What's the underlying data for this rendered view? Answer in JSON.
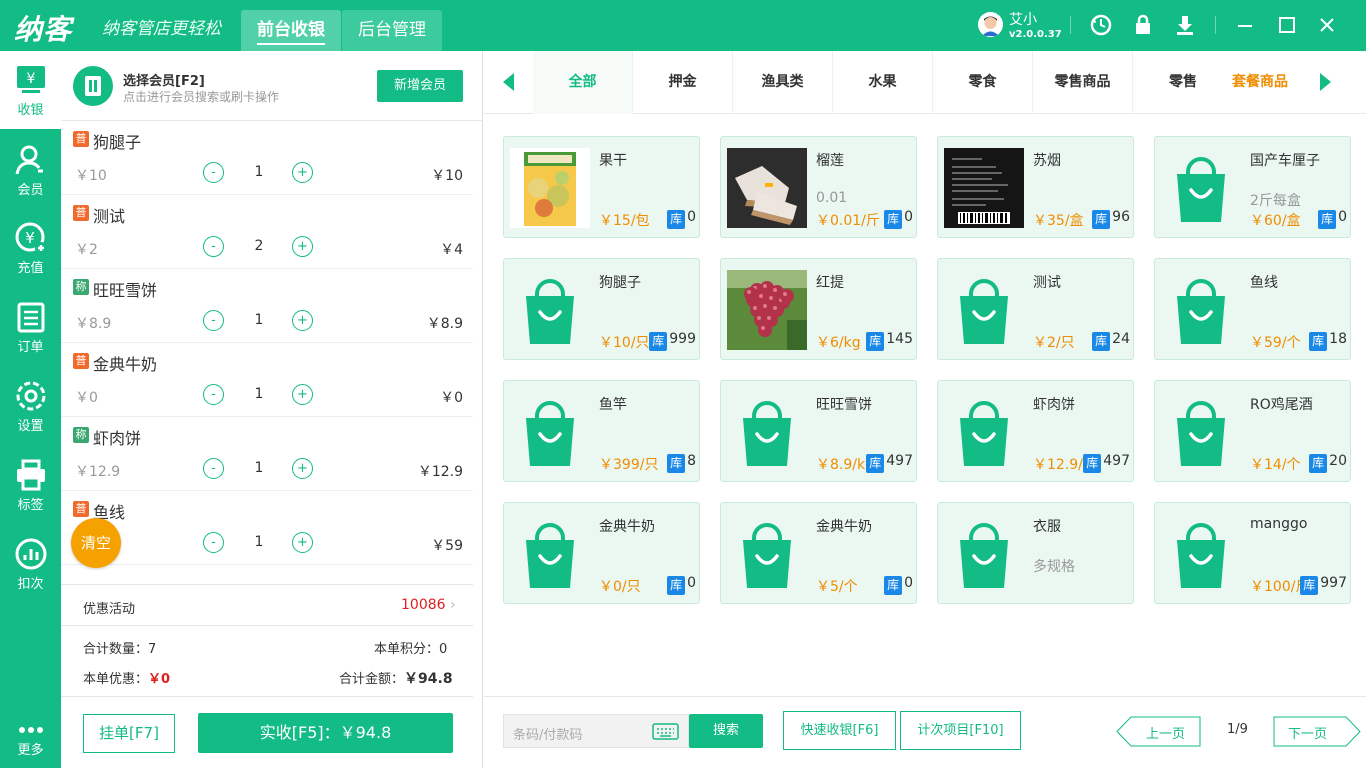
{
  "app": {
    "logo": "纳客",
    "slogan": "纳客管店更轻松",
    "nav_tabs": [
      {
        "label": "前台收银"
      },
      {
        "label": "后台管理"
      }
    ],
    "user": {
      "name": "艾小",
      "version": "v2.0.0.37"
    },
    "accent_color": "#13bb85"
  },
  "sidebar": {
    "items": [
      {
        "label": "收银",
        "icon": "cashier-icon"
      },
      {
        "label": "会员",
        "icon": "member-icon"
      },
      {
        "label": "充值",
        "icon": "recharge-icon"
      },
      {
        "label": "订单",
        "icon": "order-icon"
      },
      {
        "label": "设置",
        "icon": "settings-icon"
      },
      {
        "label": "标签",
        "icon": "printer-icon"
      },
      {
        "label": "扣次",
        "icon": "deduct-icon"
      },
      {
        "label": "更多",
        "icon": "more-icon"
      }
    ]
  },
  "member": {
    "title": "选择会员[F2]",
    "subtitle": "点击进行会员搜索或刷卡操作",
    "add_button": "新增会员"
  },
  "cart": {
    "items": [
      {
        "tag": "普",
        "name": "狗腿子",
        "price": "￥10",
        "qty": "1",
        "total": "￥10"
      },
      {
        "tag": "普",
        "name": "测试",
        "price": "￥2",
        "qty": "2",
        "total": "￥4"
      },
      {
        "tag": "称",
        "name": "旺旺雪饼",
        "price": "￥8.9",
        "qty": "1",
        "total": "￥8.9"
      },
      {
        "tag": "普",
        "name": "金典牛奶",
        "price": "￥0",
        "qty": "1",
        "total": "￥0"
      },
      {
        "tag": "称",
        "name": "虾肉饼",
        "price": "￥12.9",
        "qty": "1",
        "total": "￥12.9"
      },
      {
        "tag": "普",
        "name": "鱼线",
        "price": "",
        "qty": "1",
        "total": "￥59"
      }
    ],
    "minus": "-",
    "plus": "+",
    "clear_button": "清空"
  },
  "summary": {
    "promo_label": "优惠活动",
    "promo_value": "10086",
    "total_qty_label": "合计数量：",
    "total_qty": "7",
    "points_label": "本单积分：",
    "points": "0",
    "discount_label": "本单优惠：",
    "discount": "￥0",
    "amount_label": "合计金额：",
    "amount": "￥94.8",
    "hold_button": "挂单[F7]",
    "pay_button": "实收[F5]：￥94.8"
  },
  "categories": [
    "全部",
    "押金",
    "渔具类",
    "水果",
    "零食",
    "零售商品",
    "零售",
    "套餐商品"
  ],
  "active_category": "全部",
  "products": [
    {
      "name": "果干",
      "spec": "",
      "price": "￥15/包",
      "stock": "0",
      "image": "dried-fruit-photo"
    },
    {
      "name": "榴莲",
      "spec": "0.01",
      "price": "￥0.01/斤",
      "stock": "0",
      "image": "sneaker-photo"
    },
    {
      "name": "苏烟",
      "spec": "",
      "price": "￥35/盒",
      "stock": "96",
      "image": "cigarette-box-photo"
    },
    {
      "name": "国产车厘子",
      "spec": "2斤每盒",
      "price": "￥60/盒",
      "stock": "0",
      "image": "bag-icon"
    },
    {
      "name": "狗腿子",
      "spec": "",
      "price": "￥10/只",
      "stock": "999",
      "image": "bag-icon"
    },
    {
      "name": "红提",
      "spec": "",
      "price": "￥6/kg",
      "stock": "145",
      "image": "grape-photo"
    },
    {
      "name": "测试",
      "spec": "",
      "price": "￥2/只",
      "stock": "24",
      "image": "bag-icon"
    },
    {
      "name": "鱼线",
      "spec": "",
      "price": "￥59/个",
      "stock": "18",
      "image": "bag-icon"
    },
    {
      "name": "鱼竿",
      "spec": "",
      "price": "￥399/只",
      "stock": "8",
      "image": "bag-icon"
    },
    {
      "name": "旺旺雪饼",
      "spec": "",
      "price": "￥8.9/kg",
      "stock": "497",
      "image": "bag-icon"
    },
    {
      "name": "虾肉饼",
      "spec": "",
      "price": "￥12.9/k",
      "stock": "497",
      "image": "bag-icon"
    },
    {
      "name": "RO鸡尾酒",
      "spec": "",
      "price": "￥14/个",
      "stock": "20",
      "image": "bag-icon"
    },
    {
      "name": "金典牛奶",
      "spec": "",
      "price": "￥0/只",
      "stock": "0",
      "image": "bag-icon"
    },
    {
      "name": "金典牛奶",
      "spec": "",
      "price": "￥5/个",
      "stock": "0",
      "image": "bag-icon"
    },
    {
      "name": "衣服",
      "spec": "多规格",
      "price": "",
      "stock": "",
      "image": "bag-icon"
    },
    {
      "name": "manggo",
      "spec": "",
      "price": "￥100/斤",
      "stock": "997",
      "image": "bag-icon"
    }
  ],
  "stock_label": "库",
  "bottom": {
    "barcode_placeholder": "条码/付款码",
    "search_button": "搜索",
    "quick_button": "快速收银[F6]",
    "count_button": "计次项目[F10]",
    "prev_button": "上一页",
    "page": "1/9",
    "next_button": "下一页"
  }
}
